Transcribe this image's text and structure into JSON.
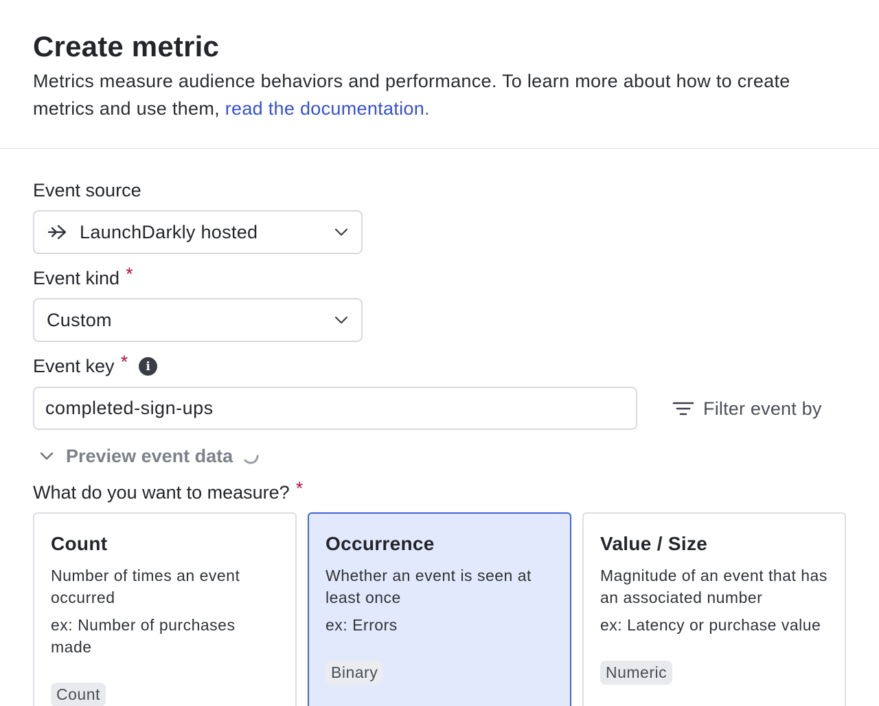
{
  "header": {
    "title": "Create metric",
    "description": "Metrics measure audience behaviors and performance. To learn more about how to create metrics and use them, ",
    "doc_link": "read the documentation."
  },
  "event_source": {
    "label": "Event source",
    "value": "LaunchDarkly hosted",
    "icon": "arrow-right-icon"
  },
  "event_kind": {
    "label": "Event kind",
    "required_mark": "*",
    "value": "Custom"
  },
  "event_key": {
    "label": "Event key",
    "required_mark": "*",
    "info_glyph": "i",
    "value": "completed-sign-ups"
  },
  "filter": {
    "label": "Filter event by",
    "icon": "filter-icon"
  },
  "preview": {
    "label": "Preview event data",
    "loading": true
  },
  "measure": {
    "label": "What do you want to measure?",
    "required_mark": "*",
    "options": [
      {
        "title": "Count",
        "description": "Number of times an event occurred",
        "example": "ex: Number of purchases made",
        "badge": "Count",
        "selected": false
      },
      {
        "title": "Occurrence",
        "description": "Whether an event is seen at least once",
        "example": "ex: Errors",
        "badge": "Binary",
        "selected": true
      },
      {
        "title": "Value / Size",
        "description": "Magnitude of an event that has an associated number",
        "example": "ex: Latency or purchase value",
        "badge": "Numeric",
        "selected": false
      }
    ]
  },
  "colors": {
    "accent": "#3550d8",
    "required": "#b5124e",
    "selected_bg": "#e3e9fd",
    "selected_border": "#4163e0"
  }
}
